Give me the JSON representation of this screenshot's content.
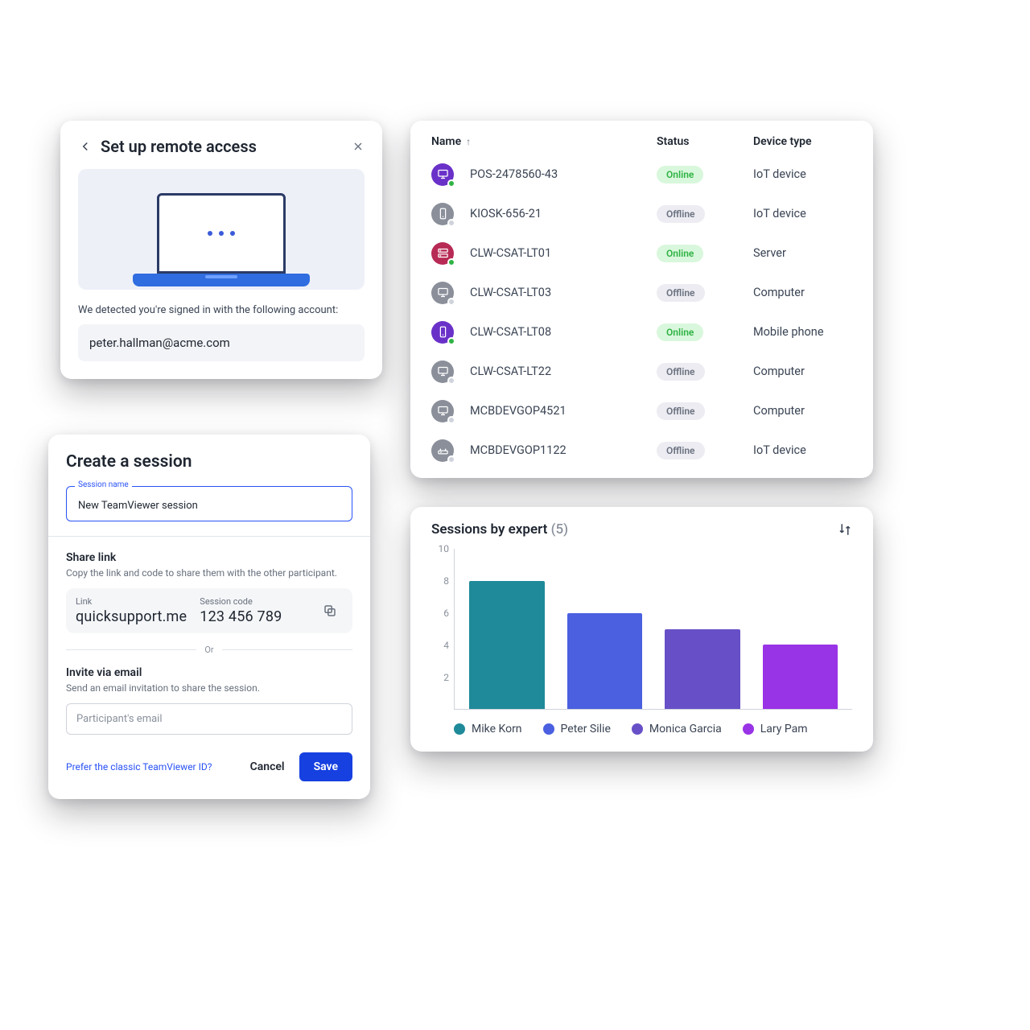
{
  "setup": {
    "title": "Set up remote access",
    "detected": "We detected you're signed in with the following account:",
    "account": "peter.hallman@acme.com"
  },
  "session": {
    "title": "Create a session",
    "name_label": "Session name",
    "name_value": "New TeamViewer session",
    "share_title": "Share link",
    "share_sub": "Copy the link and code to share them with the other participant.",
    "link_label": "Link",
    "link_value": "quicksupport.me",
    "code_label": "Session code",
    "code_value": "123 456 789",
    "or": "Or",
    "invite_title": "Invite via email",
    "invite_sub": "Send an email invitation to share the session.",
    "email_placeholder": "Participant's email",
    "classic_link": "Prefer the classic TeamViewer ID?",
    "cancel": "Cancel",
    "save": "Save"
  },
  "table": {
    "headers": {
      "name": "Name",
      "status": "Status",
      "type": "Device type"
    },
    "status_labels": {
      "online": "Online",
      "offline": "Offline"
    },
    "rows": [
      {
        "name": "POS-2478560-43",
        "status": "online",
        "type": "IoT device",
        "iconColor": "purple",
        "icon": "monitor"
      },
      {
        "name": "KIOSK-656-21",
        "status": "offline",
        "type": "IoT device",
        "iconColor": "gray",
        "icon": "phone"
      },
      {
        "name": "CLW-CSAT-LT01",
        "status": "online",
        "type": "Server",
        "iconColor": "red",
        "icon": "server"
      },
      {
        "name": "CLW-CSAT-LT03",
        "status": "offline",
        "type": "Computer",
        "iconColor": "gray",
        "icon": "monitor"
      },
      {
        "name": "CLW-CSAT-LT08",
        "status": "online",
        "type": "Mobile phone",
        "iconColor": "purple",
        "icon": "phone"
      },
      {
        "name": "CLW-CSAT-LT22",
        "status": "offline",
        "type": "Computer",
        "iconColor": "gray",
        "icon": "monitor"
      },
      {
        "name": "MCBDEVGOP4521",
        "status": "offline",
        "type": "Computer",
        "iconColor": "gray",
        "icon": "monitor"
      },
      {
        "name": "MCBDEVGOP1122",
        "status": "offline",
        "type": "IoT device",
        "iconColor": "gray",
        "icon": "router"
      }
    ]
  },
  "chart_data": {
    "type": "bar",
    "title": "Sessions by expert",
    "count_suffix": "(5)",
    "ylim": [
      0,
      10
    ],
    "yticks": [
      2,
      4,
      6,
      8,
      10
    ],
    "categories": [
      "Mike Korn",
      "Peter Silie",
      "Monica Garcia",
      "Lary Pam"
    ],
    "values": [
      8,
      6,
      5,
      4
    ],
    "colors": [
      "#1f8a99",
      "#4a60e0",
      "#6750c7",
      "#9933e6"
    ]
  }
}
